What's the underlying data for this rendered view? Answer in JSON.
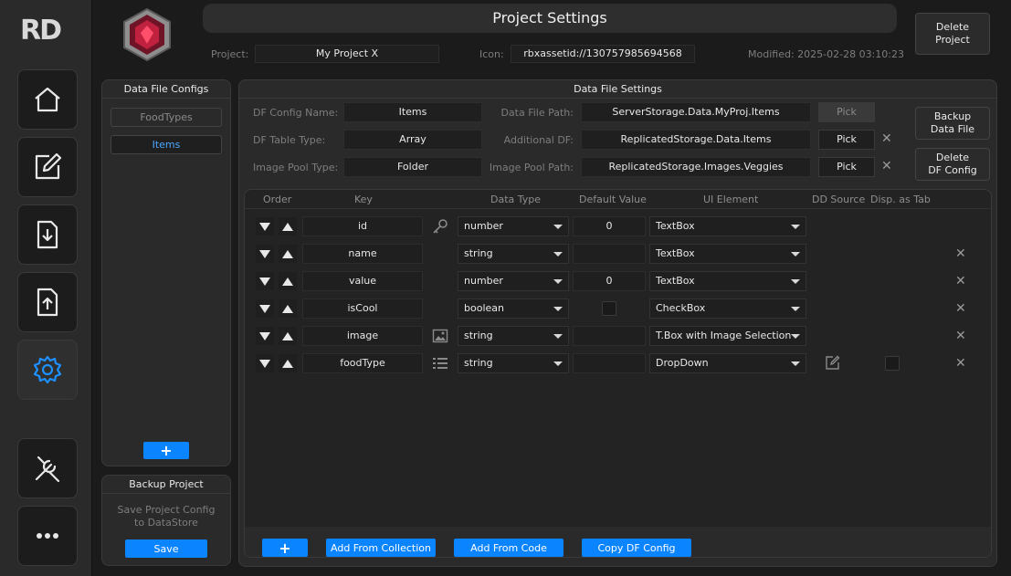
{
  "brand": {
    "logo_text": "RD"
  },
  "header": {
    "title": "Project Settings",
    "project_label": "Project:",
    "project_value": "My Project X",
    "icon_label": "Icon:",
    "icon_value": "rbxassetid://130757985694568",
    "modified": "Modified: 2025-02-28 03:10:23",
    "delete_project_label": "Delete\nProject"
  },
  "nav": {
    "items": [
      {
        "icon": "home-icon"
      },
      {
        "icon": "edit-icon"
      },
      {
        "icon": "download-icon"
      },
      {
        "icon": "upload-icon"
      },
      {
        "icon": "gear-icon"
      },
      {
        "icon": "tools-icon"
      },
      {
        "icon": "more-icon"
      }
    ]
  },
  "configs": {
    "title": "Data File Configs",
    "items": [
      "FoodTypes",
      "Items"
    ],
    "add_label": "+"
  },
  "backup": {
    "title": "Backup Project",
    "desc_line1": "Save Project Config",
    "desc_line2": "to DataStore",
    "save_label": "Save"
  },
  "settings": {
    "title": "Data File Settings",
    "df_config_name_label": "DF Config Name:",
    "df_config_name": "Items",
    "df_table_type_label": "DF Table Type:",
    "df_table_type": "Array",
    "image_pool_type_label": "Image Pool Type:",
    "image_pool_type": "Folder",
    "data_file_path_label": "Data File Path:",
    "data_file_path": "ServerStorage.Data.MyProj.Items",
    "additional_df_label": "Additional DF:",
    "additional_df": "ReplicatedStorage.Data.Items",
    "image_pool_path_label": "Image Pool Path:",
    "image_pool_path": "ReplicatedStorage.Images.Veggies",
    "pick_label": "Pick",
    "backup_df_label": "Backup\nData File",
    "delete_df_label": "Delete\nDF Config"
  },
  "table": {
    "headers": {
      "order": "Order",
      "key": "Key",
      "data_type": "Data Type",
      "default_value": "Default Value",
      "ui_element": "UI Element",
      "dd_source": "DD Source",
      "disp_tab": "Disp. as Tab"
    },
    "rows": [
      {
        "key": "id",
        "type": "number",
        "default": "0",
        "ui": "TextBox"
      },
      {
        "key": "name",
        "type": "string",
        "default": "",
        "ui": "TextBox"
      },
      {
        "key": "value",
        "type": "number",
        "default": "0",
        "ui": "TextBox"
      },
      {
        "key": "isCool",
        "type": "boolean",
        "default": "",
        "ui": "CheckBox"
      },
      {
        "key": "image",
        "type": "string",
        "default": "",
        "ui": "T.Box with Image Selection"
      },
      {
        "key": "foodType",
        "type": "string",
        "default": "",
        "ui": "DropDown"
      }
    ]
  },
  "footer": {
    "add_label": "+",
    "add_from_collection": "Add From Collection",
    "add_from_code": "Add From Code",
    "copy_df_config": "Copy DF Config"
  },
  "colors": {
    "accent": "#0a84ff",
    "bg": "#1b1b1b",
    "panel": "#2a2a2a"
  }
}
